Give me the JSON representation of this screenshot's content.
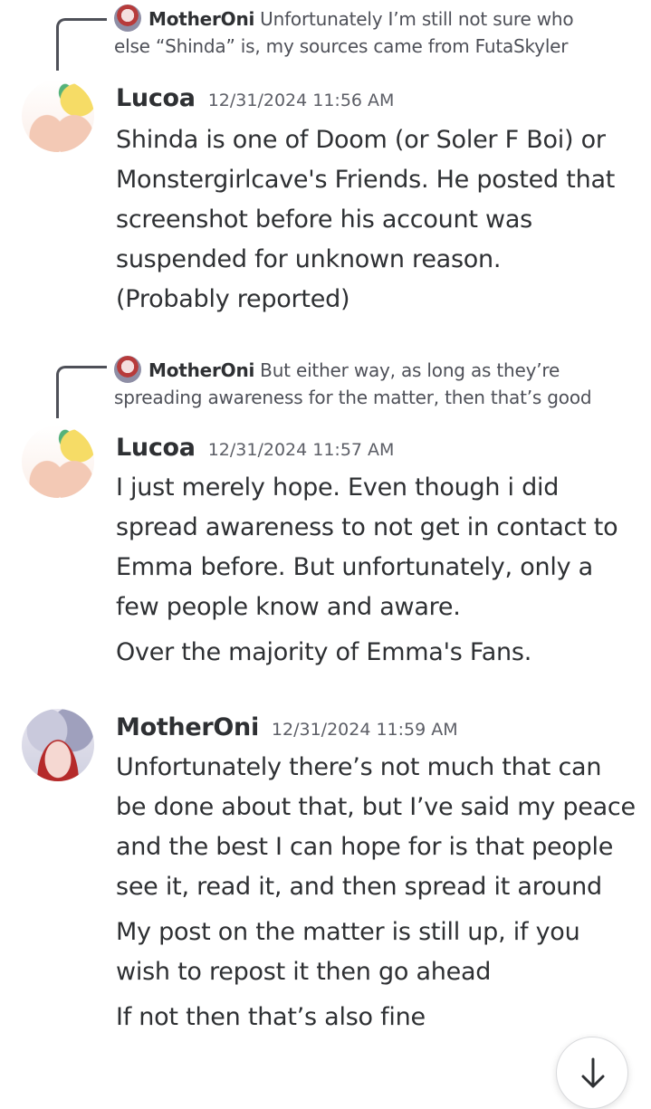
{
  "messages": [
    {
      "reply": {
        "author": "MotherOni",
        "text_line1": "Unfortunately I’m still not sure who",
        "text_line2": "else “Shinda” is, my sources came from FutaSkyler"
      },
      "author": "Lucoa",
      "timestamp": "12/31/2024 11:56 AM",
      "paragraphs": [
        "Shinda is one of Doom (or Soler F Boi) or Monstergirlcave's Friends. He posted that screenshot before his account was suspended for unknown reason.",
        "(Probably reported)"
      ]
    },
    {
      "reply": {
        "author": "MotherOni",
        "text_line1": "But either way, as long as they’re",
        "text_line2": "spreading awareness for the matter, then that’s good"
      },
      "author": "Lucoa",
      "timestamp": "12/31/2024 11:57 AM",
      "paragraphs": [
        "I just merely hope. Even though i did spread awareness to not get in contact to Emma before. But unfortunately, only a few people know and aware.",
        "Over the majority of Emma's Fans."
      ]
    },
    {
      "author": "MotherOni",
      "timestamp": "12/31/2024 11:59 AM",
      "paragraphs": [
        "Unfortunately there’s not much that can be done about that, but I’ve said my peace and the best I can hope for is that people see it, read it, and then spread it around",
        "My post on the matter is still up, if you wish to repost it then go ahead",
        "If not then that’s also fine"
      ]
    }
  ],
  "jump_button_icon": "arrow-down-icon"
}
